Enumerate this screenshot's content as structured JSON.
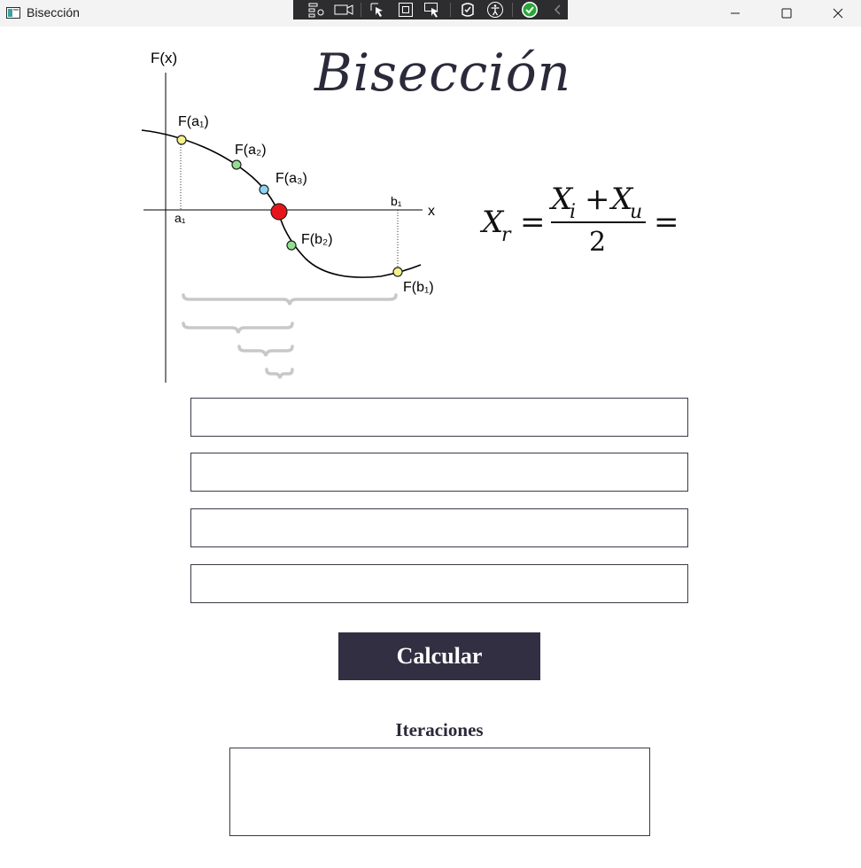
{
  "window": {
    "title": "Bisección",
    "minimize_icon": "minimize-icon",
    "maximize_icon": "maximize-icon",
    "close_icon": "close-icon"
  },
  "debug_toolbar": {
    "icons": [
      "live-visual-tree-icon",
      "record-icon",
      "select-element-icon",
      "display-layout-adorners-icon",
      "track-focus-icon",
      "hot-reload-icon",
      "accessibility-icon",
      "validation-check-icon",
      "collapse-chevron-icon"
    ]
  },
  "graph": {
    "y_axis_label": "F(x)",
    "x_axis_label": "x",
    "a1_label": "a₁",
    "b1_label": "b₁",
    "points": [
      "F(a₁)",
      "F(a₂)",
      "F(a₃)",
      "F(b₂)",
      "F(b₁)"
    ],
    "colors": {
      "yellow": "#f5f08a",
      "green": "#8fe08f",
      "blue": "#8fd4f0",
      "red": "#e8141b",
      "brace": "#c8c8c8"
    }
  },
  "app_title": "Bisección",
  "formula": {
    "lhs": "X",
    "lhs_sub": "r",
    "num_a": "X",
    "num_a_sub": "i",
    "plus": "+",
    "num_b": "X",
    "num_b_sub": "u",
    "denominator": "2",
    "equals": "="
  },
  "inputs": [
    {
      "value": "",
      "placeholder": ""
    },
    {
      "value": "",
      "placeholder": ""
    },
    {
      "value": "",
      "placeholder": ""
    },
    {
      "value": "",
      "placeholder": ""
    }
  ],
  "calculate_label": "Calcular",
  "iterations_label": "Iteraciones",
  "iterations_text": "",
  "colors": {
    "accent": "#332f42",
    "border": "#3a3a48"
  }
}
